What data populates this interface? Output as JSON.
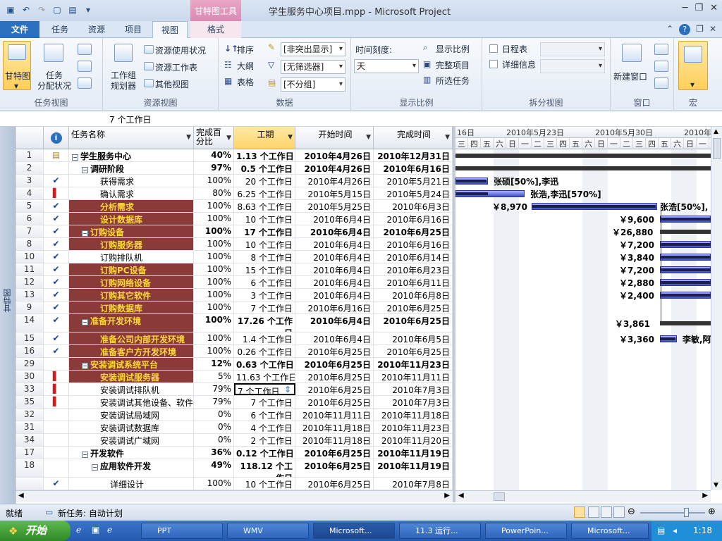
{
  "window": {
    "title": "学生服务中心项目.mpp  -  Microsoft Project",
    "context_group": "甘特图工具"
  },
  "tabs": [
    "文件",
    "任务",
    "资源",
    "项目",
    "视图",
    "格式"
  ],
  "ribbon": {
    "task_views": {
      "gantt": "甘特图",
      "task_usage": "任务\n分配状况",
      "label": "任务视图"
    },
    "resource_views": {
      "team_planner": "工作组\n规划器",
      "resource_usage": "资源使用状况",
      "resource_sheet": "资源工作表",
      "other_views": "其他视图",
      "label": "资源视图"
    },
    "data": {
      "sort": "排序",
      "outline": "大纲",
      "tables": "表格",
      "highlight": "[非突出显示]",
      "filter": "[无筛选器]",
      "group": "[不分组]",
      "label": "数据"
    },
    "zoom": {
      "timescale_label": "时间刻度:",
      "timescale_value": "天",
      "zoom": "显示比例",
      "entire_project": "完整项目",
      "selected_tasks": "所选任务",
      "label": "显示比例"
    },
    "split_view": {
      "timeline": "日程表",
      "details": "详细信息",
      "label": "拆分视图"
    },
    "window": {
      "new_window": "新建窗口",
      "label": "窗口"
    },
    "macros": {
      "label": "宏"
    }
  },
  "entry_bar": "7 个工作日",
  "side_label": "甘特图",
  "columns": {
    "name": "任务名称",
    "pct": "完成百\n分比",
    "duration": "工期",
    "start": "开始时间",
    "finish": "完成时间"
  },
  "timescale": {
    "weeks": [
      "16日",
      "2010年5月23日",
      "2010年5月30日",
      "2010年"
    ],
    "days": [
      "三",
      "四",
      "五",
      "六",
      "日",
      "一",
      "二",
      "三",
      "四",
      "五",
      "六",
      "日",
      "一",
      "二",
      "三",
      "四",
      "五",
      "六",
      "日",
      "一"
    ]
  },
  "rows": [
    {
      "id": "1",
      "ind": "note",
      "name": "学生服务中心",
      "level": 0,
      "pct": "40%",
      "dur": "1.13 个工作日",
      "start": "2010年4月26日",
      "fin": "2010年12月31日",
      "summary": true,
      "red": false
    },
    {
      "id": "2",
      "ind": "",
      "name": "调研阶段",
      "level": 1,
      "pct": "97%",
      "dur": "0.5 个工作日",
      "start": "2010年4月26日",
      "fin": "2010年6月16日",
      "summary": true,
      "red": false
    },
    {
      "id": "3",
      "ind": "check",
      "name": "获得需求",
      "level": 2,
      "pct": "100%",
      "dur": "20 个工作日",
      "start": "2010年4月26日",
      "fin": "2010年5月21日",
      "summary": false,
      "red": false
    },
    {
      "id": "4",
      "ind": "person",
      "name": "确认需求",
      "level": 2,
      "pct": "80%",
      "dur": "6.25 个工作日",
      "start": "2010年5月15日",
      "fin": "2010年5月24日",
      "summary": false,
      "red": false
    },
    {
      "id": "5",
      "ind": "check",
      "name": "分析需求",
      "level": 2,
      "pct": "100%",
      "dur": "8.63 个工作日",
      "start": "2010年5月25日",
      "fin": "2010年6月3日",
      "summary": false,
      "red": true
    },
    {
      "id": "6",
      "ind": "check",
      "name": "设计数据库",
      "level": 2,
      "pct": "100%",
      "dur": "10 个工作日",
      "start": "2010年6月4日",
      "fin": "2010年6月16日",
      "summary": false,
      "red": true
    },
    {
      "id": "7",
      "ind": "check",
      "name": "订购设备",
      "level": 1,
      "pct": "100%",
      "dur": "17 个工作日",
      "start": "2010年6月4日",
      "fin": "2010年6月25日",
      "summary": true,
      "red": true
    },
    {
      "id": "8",
      "ind": "check",
      "name": "订购服务器",
      "level": 2,
      "pct": "100%",
      "dur": "10 个工作日",
      "start": "2010年6月4日",
      "fin": "2010年6月16日",
      "summary": false,
      "red": true
    },
    {
      "id": "10",
      "ind": "check",
      "name": "订购排队机",
      "level": 2,
      "pct": "100%",
      "dur": "8 个工作日",
      "start": "2010年6月4日",
      "fin": "2010年6月14日",
      "summary": false,
      "red": false
    },
    {
      "id": "11",
      "ind": "check",
      "name": "订购PC设备",
      "level": 2,
      "pct": "100%",
      "dur": "15 个工作日",
      "start": "2010年6月4日",
      "fin": "2010年6月23日",
      "summary": false,
      "red": true
    },
    {
      "id": "12",
      "ind": "check",
      "name": "订购网络设备",
      "level": 2,
      "pct": "100%",
      "dur": "6 个工作日",
      "start": "2010年6月4日",
      "fin": "2010年6月11日",
      "summary": false,
      "red": true
    },
    {
      "id": "13",
      "ind": "check",
      "name": "订购其它软件",
      "level": 2,
      "pct": "100%",
      "dur": "3 个工作日",
      "start": "2010年6月4日",
      "fin": "2010年6月8日",
      "summary": false,
      "red": true
    },
    {
      "id": "9",
      "ind": "check",
      "name": "订购数据库",
      "level": 2,
      "pct": "100%",
      "dur": "7 个工作日",
      "start": "2010年6月16日",
      "fin": "2010年6月25日",
      "summary": false,
      "red": true
    },
    {
      "id": "14",
      "ind": "check",
      "name": "准备开发环境",
      "level": 1,
      "pct": "100%",
      "dur": "17.26 个工作日",
      "start": "2010年6月4日",
      "fin": "2010年6月25日",
      "summary": true,
      "red": true,
      "tall": true
    },
    {
      "id": "15",
      "ind": "check",
      "name": "准备公司内部开发环境",
      "level": 2,
      "pct": "100%",
      "dur": "1.4 个工作日",
      "start": "2010年6月4日",
      "fin": "2010年6月5日",
      "summary": false,
      "red": true
    },
    {
      "id": "16",
      "ind": "check",
      "name": "准备客户方开发环境",
      "level": 2,
      "pct": "100%",
      "dur": "0.26 个工作日",
      "start": "2010年6月25日",
      "fin": "2010年6月25日",
      "summary": false,
      "red": true
    },
    {
      "id": "29",
      "ind": "",
      "name": "安装调试系统平台",
      "level": 1,
      "pct": "12%",
      "dur": "0.63 个工作日",
      "start": "2010年6月25日",
      "fin": "2010年11月23日",
      "summary": true,
      "red": true
    },
    {
      "id": "30",
      "ind": "person",
      "name": "安装调试服务器",
      "level": 2,
      "pct": "5%",
      "dur": "11.63 个工作日",
      "start": "2010年6月25日",
      "fin": "2010年11月11日",
      "summary": false,
      "red": true
    },
    {
      "id": "33",
      "ind": "person",
      "name": "安装调试排队机",
      "level": 2,
      "pct": "79%",
      "dur": "7 个工作日",
      "start": "2010年6月25日",
      "fin": "2010年7月3日",
      "summary": false,
      "red": false,
      "editing": true
    },
    {
      "id": "35",
      "ind": "person",
      "name": "安装调试其他设备、软件",
      "level": 2,
      "pct": "79%",
      "dur": "7 个工作日",
      "start": "2010年6月25日",
      "fin": "2010年7月3日",
      "summary": false,
      "red": false
    },
    {
      "id": "32",
      "ind": "",
      "name": "安装调试局域网",
      "level": 2,
      "pct": "0%",
      "dur": "6 个工作日",
      "start": "2010年11月11日",
      "fin": "2010年11月18日",
      "summary": false,
      "red": false
    },
    {
      "id": "31",
      "ind": "",
      "name": "安装调试数据库",
      "level": 2,
      "pct": "0%",
      "dur": "4 个工作日",
      "start": "2010年11月18日",
      "fin": "2010年11月23日",
      "summary": false,
      "red": false
    },
    {
      "id": "34",
      "ind": "",
      "name": "安装调试广域网",
      "level": 2,
      "pct": "0%",
      "dur": "2 个工作日",
      "start": "2010年11月18日",
      "fin": "2010年11月20日",
      "summary": false,
      "red": false
    },
    {
      "id": "17",
      "ind": "",
      "name": "开发软件",
      "level": 1,
      "pct": "36%",
      "dur": "0.12 个工作日",
      "start": "2010年6月25日",
      "fin": "2010年11月19日",
      "summary": true,
      "red": false
    },
    {
      "id": "18",
      "ind": "",
      "name": "应用软件开发",
      "level": 2,
      "pct": "49%",
      "dur": "118.12 个工作日",
      "start": "2010年6月25日",
      "fin": "2010年11月19日",
      "summary": true,
      "red": false,
      "tall": true
    },
    {
      "id": "",
      "ind": "check",
      "name": "详细设计",
      "level": 3,
      "pct": "100%",
      "dur": "10 个工作日",
      "start": "2010年6月25日",
      "fin": "2010年7月8日",
      "summary": false,
      "red": false
    }
  ],
  "gantt_labels": {
    "r3": "张硕[50%],李迅",
    "r4": "张浩,李迅[570%]",
    "r5_cost": "￥8,970",
    "r5_res": "张浩[50%],",
    "r6": "￥9,600",
    "r7": "￥26,880",
    "r8": "￥7,200",
    "r10": "￥3,840",
    "r11": "￥7,200",
    "r12": "￥2,880",
    "r13": "￥2,400",
    "r14": "￥3,861",
    "r15_cost": "￥3,360",
    "r15_res": "李敏,阿"
  },
  "status": {
    "ready": "就绪",
    "new_tasks": "新任务: 自动计划"
  },
  "taskbar": {
    "start": "开始",
    "items": [
      "PPT",
      "WMV",
      "Microsoft...",
      "11.3 运行...",
      "PowerPoin...",
      "Microsoft..."
    ],
    "clock": "1:18"
  },
  "colors": {
    "highlight_row_bg": "#8b3a3a",
    "highlight_row_text": "#ffd93a",
    "gantt_bar": "#3d4cc6"
  }
}
